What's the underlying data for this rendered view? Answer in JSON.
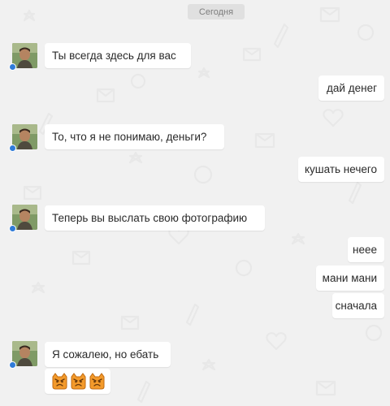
{
  "chat": {
    "date_label": "Сегодня",
    "messages": [
      {
        "direction": "in",
        "text": "Ты всегда здесь для вас",
        "avatar": "contact-avatar"
      },
      {
        "direction": "out",
        "text": "дай денег"
      },
      {
        "direction": "in",
        "text": "То, что я не понимаю, деньги?",
        "avatar": "contact-avatar"
      },
      {
        "direction": "out",
        "text": "кушать нечего"
      },
      {
        "direction": "in",
        "text": "Теперь вы выслать свою фотографию",
        "avatar": "contact-avatar"
      },
      {
        "direction": "out",
        "text": "неее"
      },
      {
        "direction": "out",
        "text": "мани мани"
      },
      {
        "direction": "out",
        "text": "сначала"
      },
      {
        "direction": "in",
        "text": "Я сожалею, но ебать",
        "avatar": "contact-avatar"
      },
      {
        "direction": "in",
        "type": "emoji",
        "emojis": [
          "angry-cat-emoji",
          "angry-cat-emoji",
          "angry-cat-emoji"
        ]
      }
    ]
  },
  "colors": {
    "background": "#f1f1f1",
    "bubble": "#ffffff",
    "online_dot": "#2f7bd8",
    "emoji_fill": "#f39a2b"
  }
}
